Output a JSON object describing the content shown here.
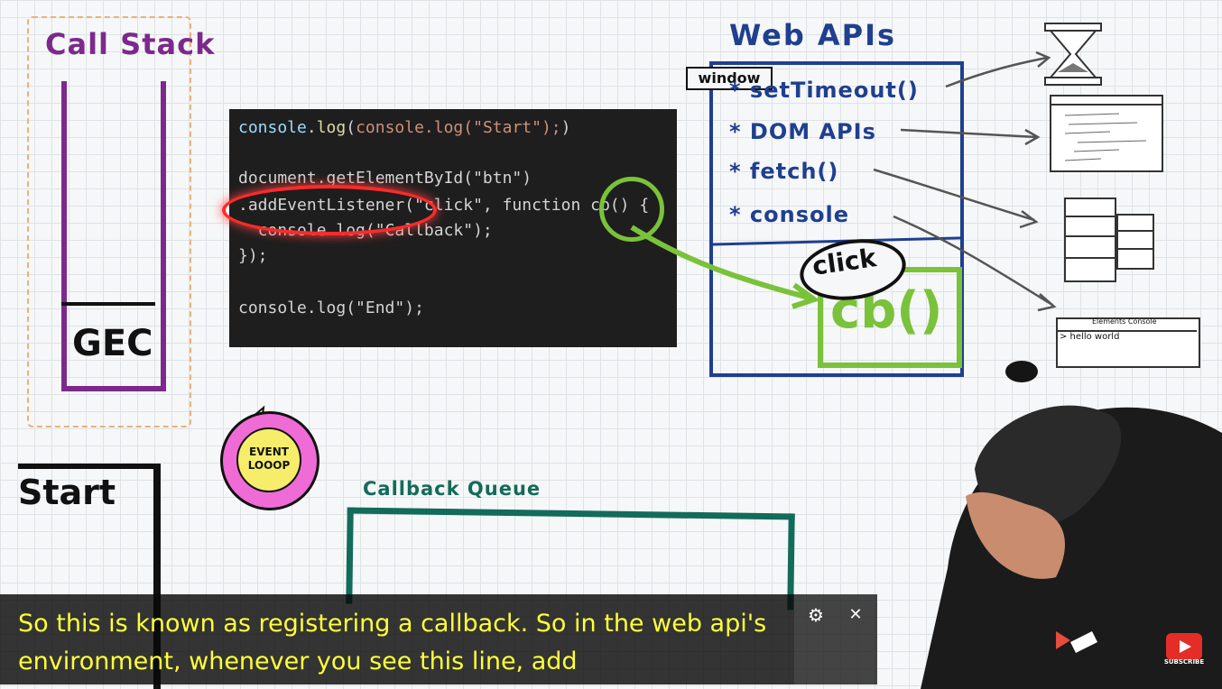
{
  "diagram": {
    "call_stack": {
      "title": "Call Stack",
      "frame": "GEC"
    },
    "code": {
      "lines": [
        "console.log(\"Start\");",
        "document.getElementById(\"btn\")",
        ".addEventListener(\"click\", function cb() {",
        "  console.log(\"Callback\");",
        "});",
        "console.log(\"End\");"
      ]
    },
    "web_apis": {
      "title": "Web APIs",
      "window_tag": "window",
      "items": [
        "* setTimeout()",
        "* DOM APIs",
        "* fetch()",
        "* console"
      ],
      "registered_callback": "cb()",
      "event_label": "click"
    },
    "dev_console": {
      "tabs": "Elements   Console",
      "output": "> hello world"
    },
    "event_loop": {
      "label": "EVENT LOOOP"
    },
    "output": {
      "label": "Start"
    },
    "callback_queue": {
      "title": "Callback Queue"
    }
  },
  "caption": {
    "text": "So this is known as registering a callback. So in the web api's environment, whenever you see this line, add"
  },
  "controls": {
    "gear_icon": "gear-icon",
    "close_icon": "close-icon",
    "subscribe": "SUBSCRIBE"
  },
  "colors": {
    "call_stack": "#7b2a8c",
    "web_apis": "#1f3f8f",
    "callback": "#7ac23a",
    "callback_queue": "#136b5a",
    "highlight": "#ff2a2a",
    "caption_text": "#ffff3a"
  }
}
